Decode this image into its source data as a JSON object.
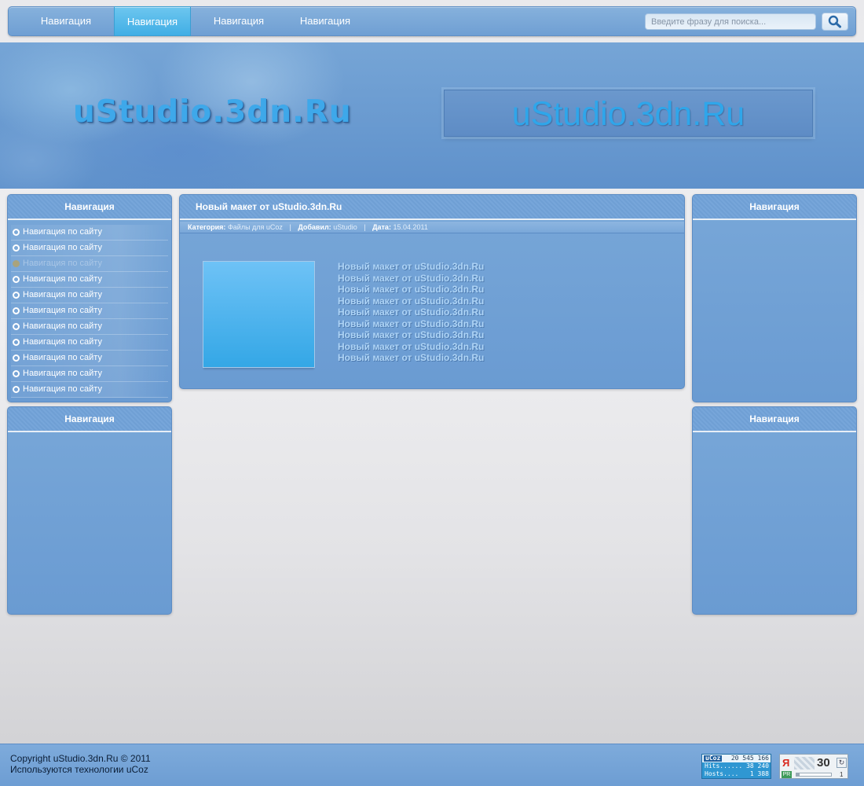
{
  "nav": {
    "items": [
      {
        "label": "Навигация",
        "active": false
      },
      {
        "label": "Навигация",
        "active": true
      },
      {
        "label": "Навигация",
        "active": false
      },
      {
        "label": "Навигация",
        "active": false
      }
    ],
    "search_placeholder": "Введите фразу для поиска...",
    "search_icon": "search-icon"
  },
  "banner": {
    "logo_left": "uStudio.3dn.Ru",
    "logo_right": "uStudio.3dn.Ru"
  },
  "left_col": {
    "block1": {
      "title": "Навигация",
      "items": [
        "Навигация по сайту",
        "Навигация по сайту",
        "Навигация по сайту",
        "Навигация по сайту",
        "Навигация по сайту",
        "Навигация по сайту",
        "Навигация по сайту",
        "Навигация по сайту",
        "Навигация по сайту",
        "Навигация по сайту",
        "Навигация по сайту"
      ],
      "dimmed_index": 2
    },
    "block2": {
      "title": "Навигация"
    }
  },
  "right_col": {
    "block1": {
      "title": "Навигация"
    },
    "block2": {
      "title": "Навигация"
    }
  },
  "article": {
    "title": "Новый макет от uStudio.3dn.Ru",
    "meta": {
      "category_label": "Категория:",
      "category": "Файлы для uCoz",
      "added_label": "Добавил:",
      "added_by": "uStudio",
      "date_label": "Дата:",
      "date": "15.04.2011"
    },
    "lines": [
      "Новый макет от uStudio.3dn.Ru",
      "Новый макет от uStudio.3dn.Ru",
      "Новый макет от uStudio.3dn.Ru",
      "Новый макет от uStudio.3dn.Ru",
      "Новый макет от uStudio.3dn.Ru",
      "Новый макет от uStudio.3dn.Ru",
      "Новый макет от uStudio.3dn.Ru",
      "Новый макет от uStudio.3dn.Ru",
      "Новый макет от uStudio.3dn.Ru"
    ]
  },
  "footer": {
    "copyright": "Copyright uStudio.3dn.Ru © 2011",
    "tech": "Используются технологии uCoz",
    "ucoz_counter": {
      "logo": "uCoz",
      "total": "20 545 166",
      "hits_label": "Hits......",
      "hits": "38 240",
      "hosts_label": "Hosts....",
      "hosts": "1 388"
    },
    "yandex_counter": {
      "logo": "Я",
      "value": "30",
      "pr_label": "PR",
      "pr_value": "1",
      "pr_fraction": 0.1
    }
  },
  "colors": {
    "accent": "#40aee5",
    "panel": "#6f9fd3",
    "text_light": "#ffffff"
  }
}
